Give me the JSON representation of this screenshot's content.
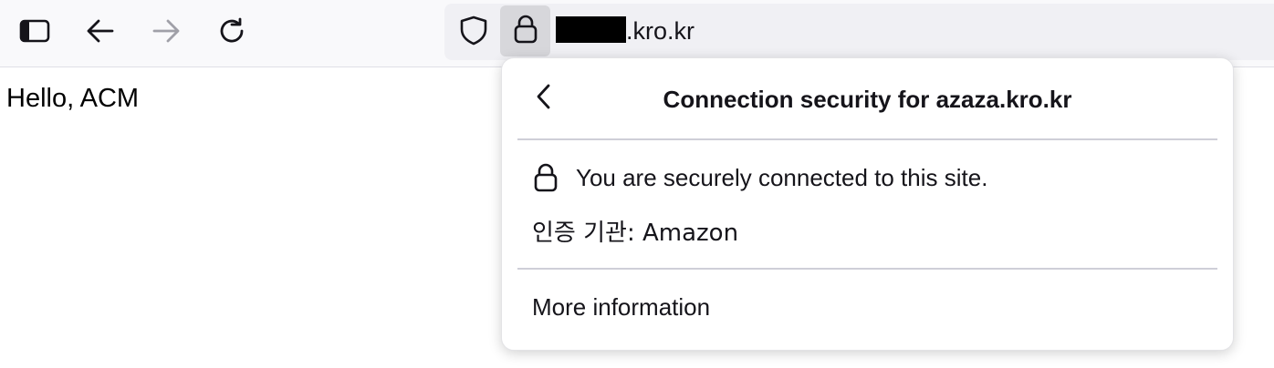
{
  "browser": {
    "url_domain_suffix": ".kro.kr",
    "buttons": {
      "sidebar": "sidebar-toggle-icon",
      "back": "arrow-left-icon",
      "forward": "arrow-right-icon",
      "reload": "reload-icon",
      "tracking_protection": "shield-icon",
      "site_info": "lock-icon"
    }
  },
  "page": {
    "body_text": "Hello, ACM"
  },
  "security_panel": {
    "title": "Connection security for azaza.kro.kr",
    "status_text": "You are securely connected to this site.",
    "issuer_text": "인증 기관: Amazon",
    "more_info_label": "More information"
  },
  "colors": {
    "toolbar_bg": "#f9f9fb",
    "urlbar_bg": "#f0f0f4",
    "lock_active_bg": "#d7d7db",
    "text": "#15141a",
    "disabled_icon": "#a0a0a8"
  }
}
